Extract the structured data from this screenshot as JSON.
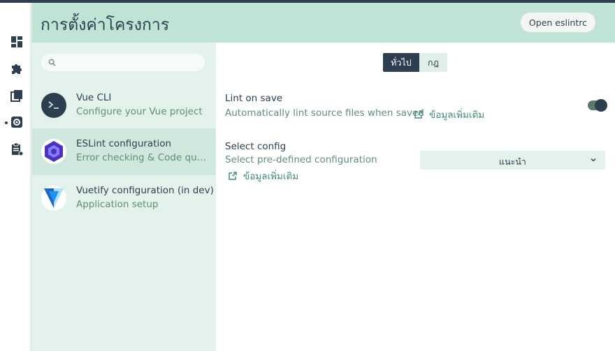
{
  "header": {
    "title": "การตั้งค่าโครงการ",
    "open_eslintrc_label": "Open eslintrc"
  },
  "rail": {
    "items": [
      {
        "icon": "dashboard-icon"
      },
      {
        "icon": "puzzle-icon"
      },
      {
        "icon": "library-icon"
      },
      {
        "icon": "settings-icon",
        "active": true
      },
      {
        "icon": "clipboard-icon"
      }
    ]
  },
  "sidebar": {
    "search_placeholder": "",
    "plugins": [
      {
        "name": "Vue CLI",
        "description": "Configure your Vue project",
        "icon": "terminal-icon",
        "selected": false
      },
      {
        "name": "ESLint configuration",
        "description": "Error checking & Code quality",
        "icon": "eslint-icon",
        "selected": true
      },
      {
        "name": "Vuetify configuration (in dev)",
        "description": "Application setup",
        "icon": "vuetify-icon",
        "selected": false
      }
    ]
  },
  "main": {
    "tabs": [
      {
        "label": "ทั่วไป",
        "active": true
      },
      {
        "label": "กฎ",
        "active": false
      }
    ],
    "lint_on_save": {
      "label": "Lint on save",
      "description": "Automatically lint source files when saved",
      "more_info": "ข้อมูลเพิ่มเติม",
      "enabled": true
    },
    "select_config": {
      "label": "Select config",
      "description": "Select pre-defined configuration",
      "more_info": "ข้อมูลเพิ่มเติม",
      "value": "แนะนำ"
    }
  },
  "colors": {
    "header_bg": "#bfe4d5",
    "sidebar_bg": "#e4f2ec",
    "accent_dark": "#2c3e50",
    "accent_green": "#3f8f6d"
  }
}
